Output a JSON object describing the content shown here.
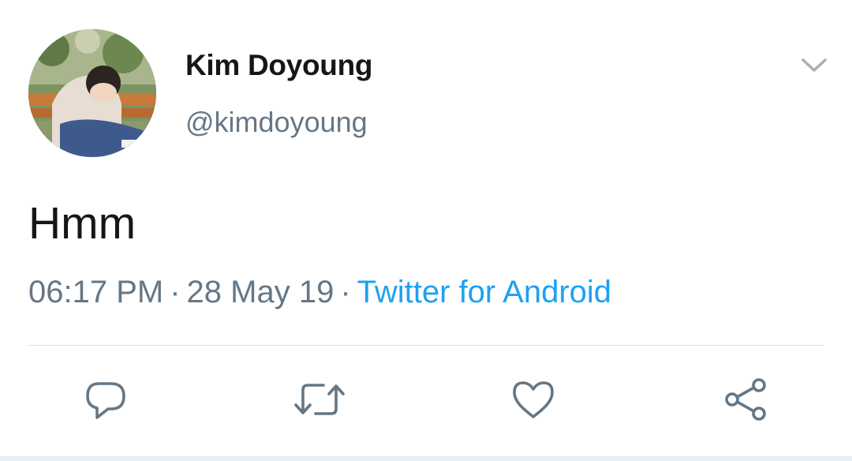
{
  "tweet": {
    "author": {
      "display_name": "Kim Doyoung",
      "handle": "@kimdoyoung",
      "avatar": "avatar-photo"
    },
    "text": "Hmm",
    "time": "06:17 PM",
    "date": "28 May 19",
    "separator": "·",
    "source": "Twitter for Android"
  },
  "icons": {
    "menu": "chevron-down-icon",
    "reply": "reply-icon",
    "retweet": "retweet-icon",
    "like": "heart-icon",
    "share": "share-icon"
  },
  "colors": {
    "text": "#14171a",
    "secondary": "#657786",
    "link": "#1da1f2",
    "divider": "#d6dde3"
  }
}
